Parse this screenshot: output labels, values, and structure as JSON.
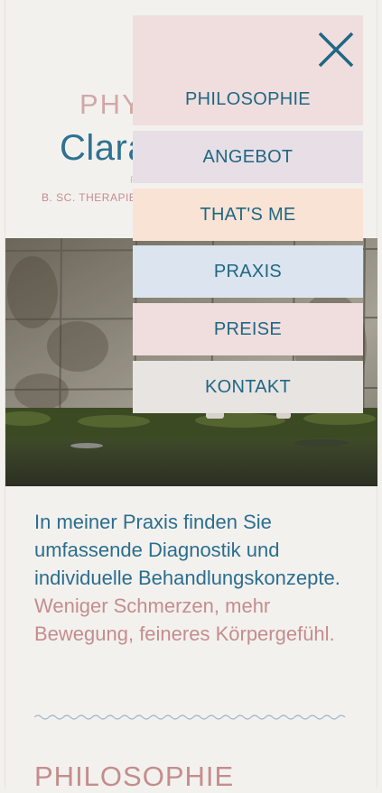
{
  "header": {
    "kicker": "PHYSIOTHERAPIE",
    "name": "Clara",
    "subtitle": "PHYSIOTHERAPEUTIN",
    "degree": "B. SC. THERAPIE"
  },
  "intro": {
    "lead": "In meiner Praxis finden Sie umfassende Diagnostik und individuelle Behandlungskonzepte.",
    "accent": "Weniger Schmerzen, mehr Bewegung, feineres Körpergefühl."
  },
  "section": {
    "title": "PHILOSOPHIE"
  },
  "menu": {
    "items": [
      {
        "label": "PHILOSOPHIE",
        "color": "#f0dede"
      },
      {
        "label": "ANGEBOT",
        "color": "#e8dfe6"
      },
      {
        "label": "THAT'S ME",
        "color": "#f9e3d5"
      },
      {
        "label": "PRAXIS",
        "color": "#dbe4ef"
      },
      {
        "label": "PREISE",
        "color": "#f0dede"
      },
      {
        "label": "KONTAKT",
        "color": "#e7e4e2"
      }
    ]
  },
  "colors": {
    "primary": "#2f7191",
    "accent": "#c48d8d",
    "background": "#f3f1ee"
  }
}
